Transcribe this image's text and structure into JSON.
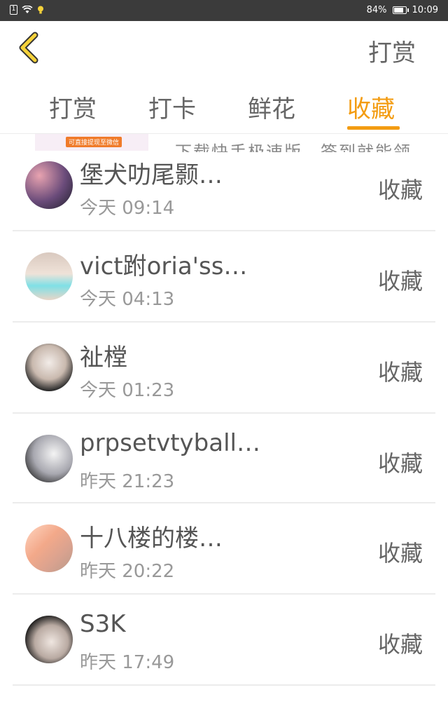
{
  "status_bar": {
    "sim": "1",
    "battery": "84%",
    "battery_level": 0.84,
    "time": "10:09"
  },
  "header": {
    "action": "打赏"
  },
  "tabs": [
    {
      "label": "打赏",
      "active": false
    },
    {
      "label": "打卡",
      "active": false
    },
    {
      "label": "鲜花",
      "active": false
    },
    {
      "label": "收藏",
      "active": true
    }
  ],
  "ad": {
    "badge": "可直接提现至微信",
    "text": "下载快手极速版，签到就能领"
  },
  "rows": [
    {
      "name": "堡犬叻尾颢…",
      "time": "今天 09:14",
      "action": "收藏"
    },
    {
      "name": "vict跗oria'ss…",
      "time": "今天 04:13",
      "action": "收藏"
    },
    {
      "name": "祉樘",
      "time": "今天 01:23",
      "action": "收藏"
    },
    {
      "name": "prpsetvtyball…",
      "time": "昨天 21:23",
      "action": "收藏"
    },
    {
      "name": "十八楼的楼…",
      "time": "昨天 20:22",
      "action": "收藏"
    },
    {
      "name": "S3K",
      "time": "昨天 17:49",
      "action": "收藏"
    }
  ],
  "colors": {
    "accent": "#f39c12",
    "back_arrow_fill": "#f5d23a",
    "status_bar_bg": "#3b3b3b"
  }
}
